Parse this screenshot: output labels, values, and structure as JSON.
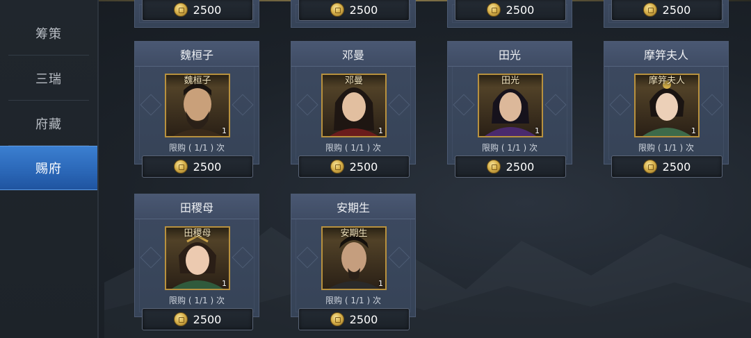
{
  "sidebar": {
    "items": [
      {
        "label": "筹策",
        "active": false
      },
      {
        "label": "三瑞",
        "active": false
      },
      {
        "label": "府藏",
        "active": false
      },
      {
        "label": "赐府",
        "active": true
      }
    ]
  },
  "top_row_prices": [
    "2500",
    "2500",
    "2500",
    "2500"
  ],
  "cards": [
    {
      "title": "魏桓子",
      "portrait_name": "魏桓子",
      "qty": "1",
      "limit": "限购 ( 1/1 ) 次",
      "price": "2500"
    },
    {
      "title": "邓曼",
      "portrait_name": "邓曼",
      "qty": "1",
      "limit": "限购 ( 1/1 ) 次",
      "price": "2500"
    },
    {
      "title": "田光",
      "portrait_name": "田光",
      "qty": "1",
      "limit": "限购 ( 1/1 ) 次",
      "price": "2500"
    },
    {
      "title": "摩笄夫人",
      "portrait_name": "摩笄夫人",
      "qty": "1",
      "limit": "限购 ( 1/1 ) 次",
      "price": "2500"
    },
    {
      "title": "田稷母",
      "portrait_name": "田稷母",
      "qty": "1",
      "limit": "限购 ( 1/1 ) 次",
      "price": "2500"
    },
    {
      "title": "安期生",
      "portrait_name": "安期生",
      "qty": "1",
      "limit": "限购 ( 1/1 ) 次",
      "price": "2500"
    }
  ],
  "colors": {
    "active_tab": "#2f6fc2",
    "card_bg": "#3a475d",
    "portrait_frame": "#b8913e",
    "coin": "#d8b24c"
  },
  "icons": {
    "currency": "gold-coin-icon"
  }
}
